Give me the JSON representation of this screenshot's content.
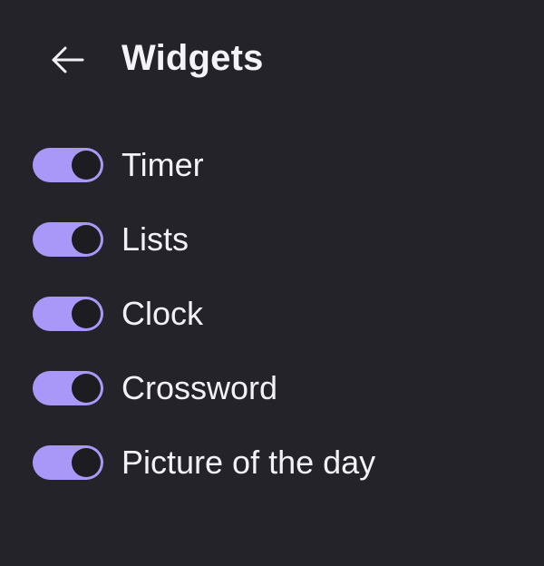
{
  "header": {
    "title": "Widgets",
    "back_icon": "arrow-left-icon"
  },
  "colors": {
    "background": "#242329",
    "toggle_on": "#a998f8",
    "toggle_knob": "#1d1c21",
    "text": "#f2f1f5"
  },
  "widgets": [
    {
      "label": "Timer",
      "enabled": true
    },
    {
      "label": "Lists",
      "enabled": true
    },
    {
      "label": "Clock",
      "enabled": true
    },
    {
      "label": "Crossword",
      "enabled": true
    },
    {
      "label": "Picture of the day",
      "enabled": true
    }
  ]
}
